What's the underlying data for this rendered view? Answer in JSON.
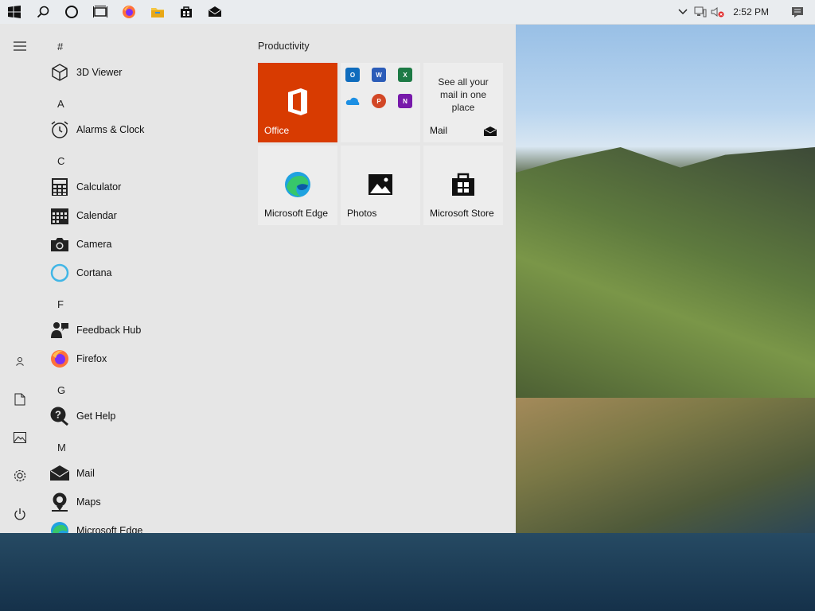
{
  "taskbar": {
    "clock": "2:52 PM",
    "left_icons": [
      "windows-logo-icon",
      "search-icon",
      "cortana-icon",
      "task-view-icon",
      "firefox-icon",
      "file-explorer-icon",
      "store-icon",
      "mail-icon"
    ],
    "tray_icons": [
      "chevron-up-icon",
      "network-icon",
      "volume-muted-icon"
    ]
  },
  "start_menu": {
    "rail": [
      "hamburger-icon",
      "user-icon",
      "documents-icon",
      "pictures-icon",
      "settings-icon",
      "power-icon"
    ],
    "sections": [
      {
        "letter": "#",
        "apps": [
          {
            "label": "3D Viewer",
            "icon": "3d-viewer-icon"
          }
        ]
      },
      {
        "letter": "A",
        "apps": [
          {
            "label": "Alarms & Clock",
            "icon": "alarm-clock-icon"
          }
        ]
      },
      {
        "letter": "C",
        "apps": [
          {
            "label": "Calculator",
            "icon": "calculator-icon"
          },
          {
            "label": "Calendar",
            "icon": "calendar-icon"
          },
          {
            "label": "Camera",
            "icon": "camera-icon"
          },
          {
            "label": "Cortana",
            "icon": "cortana-icon"
          }
        ]
      },
      {
        "letter": "F",
        "apps": [
          {
            "label": "Feedback Hub",
            "icon": "feedback-hub-icon"
          },
          {
            "label": "Firefox",
            "icon": "firefox-icon"
          }
        ]
      },
      {
        "letter": "G",
        "apps": [
          {
            "label": "Get Help",
            "icon": "get-help-icon"
          }
        ]
      },
      {
        "letter": "M",
        "apps": [
          {
            "label": "Mail",
            "icon": "mail-icon"
          },
          {
            "label": "Maps",
            "icon": "maps-icon"
          },
          {
            "label": "Microsoft Edge",
            "icon": "edge-icon"
          }
        ]
      }
    ],
    "group_title": "Productivity",
    "tiles": {
      "office": "Office",
      "office_apps": [
        "Outlook",
        "Word",
        "Excel",
        "OneDrive",
        "PowerPoint",
        "OneNote"
      ],
      "mail_text": "See all your mail in one place",
      "mail_label": "Mail",
      "edge": "Microsoft Edge",
      "photos": "Photos",
      "store": "Microsoft Store"
    }
  },
  "colors": {
    "office_tile": "#d83b01",
    "start_bg": "#e6e6e6",
    "taskbar_bg": "#e9ecef"
  }
}
